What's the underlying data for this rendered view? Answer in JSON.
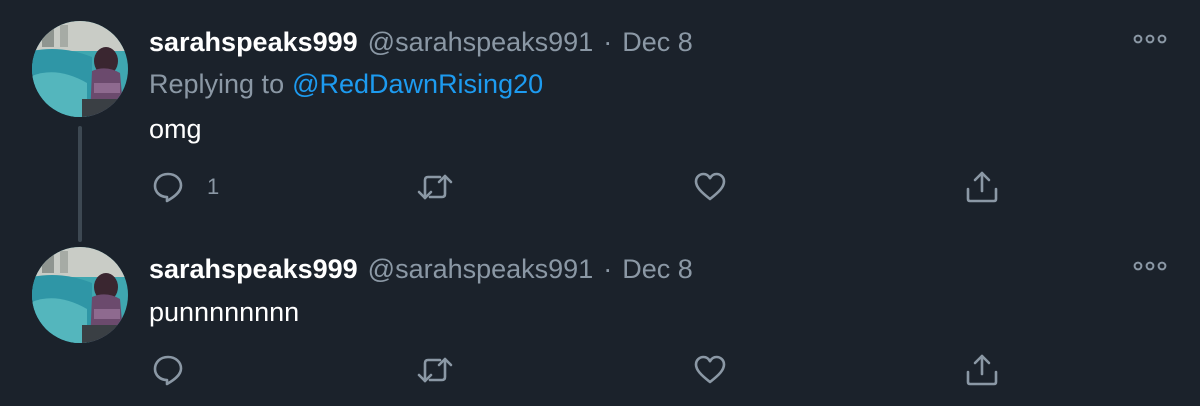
{
  "thread": {
    "tweets": [
      {
        "display_name": "sarahspeaks999",
        "handle": "@sarahspeaks991",
        "separator": "·",
        "date": "Dec 8",
        "replying_prefix": "Replying to",
        "replying_to": "@RedDawnRising20",
        "text": "omg",
        "reply_count": "1"
      },
      {
        "display_name": "sarahspeaks999",
        "handle": "@sarahspeaks991",
        "separator": "·",
        "date": "Dec 8",
        "text": "punnnnnnnn"
      }
    ]
  },
  "icons": {
    "reply": "reply-icon",
    "retweet": "retweet-icon",
    "like": "heart-icon",
    "share": "share-icon",
    "more": "more-icon"
  },
  "colors": {
    "background": "#1b222b",
    "secondary_text": "#8b98a5",
    "link": "#1d9bf0",
    "thread_line": "#3d4852"
  }
}
